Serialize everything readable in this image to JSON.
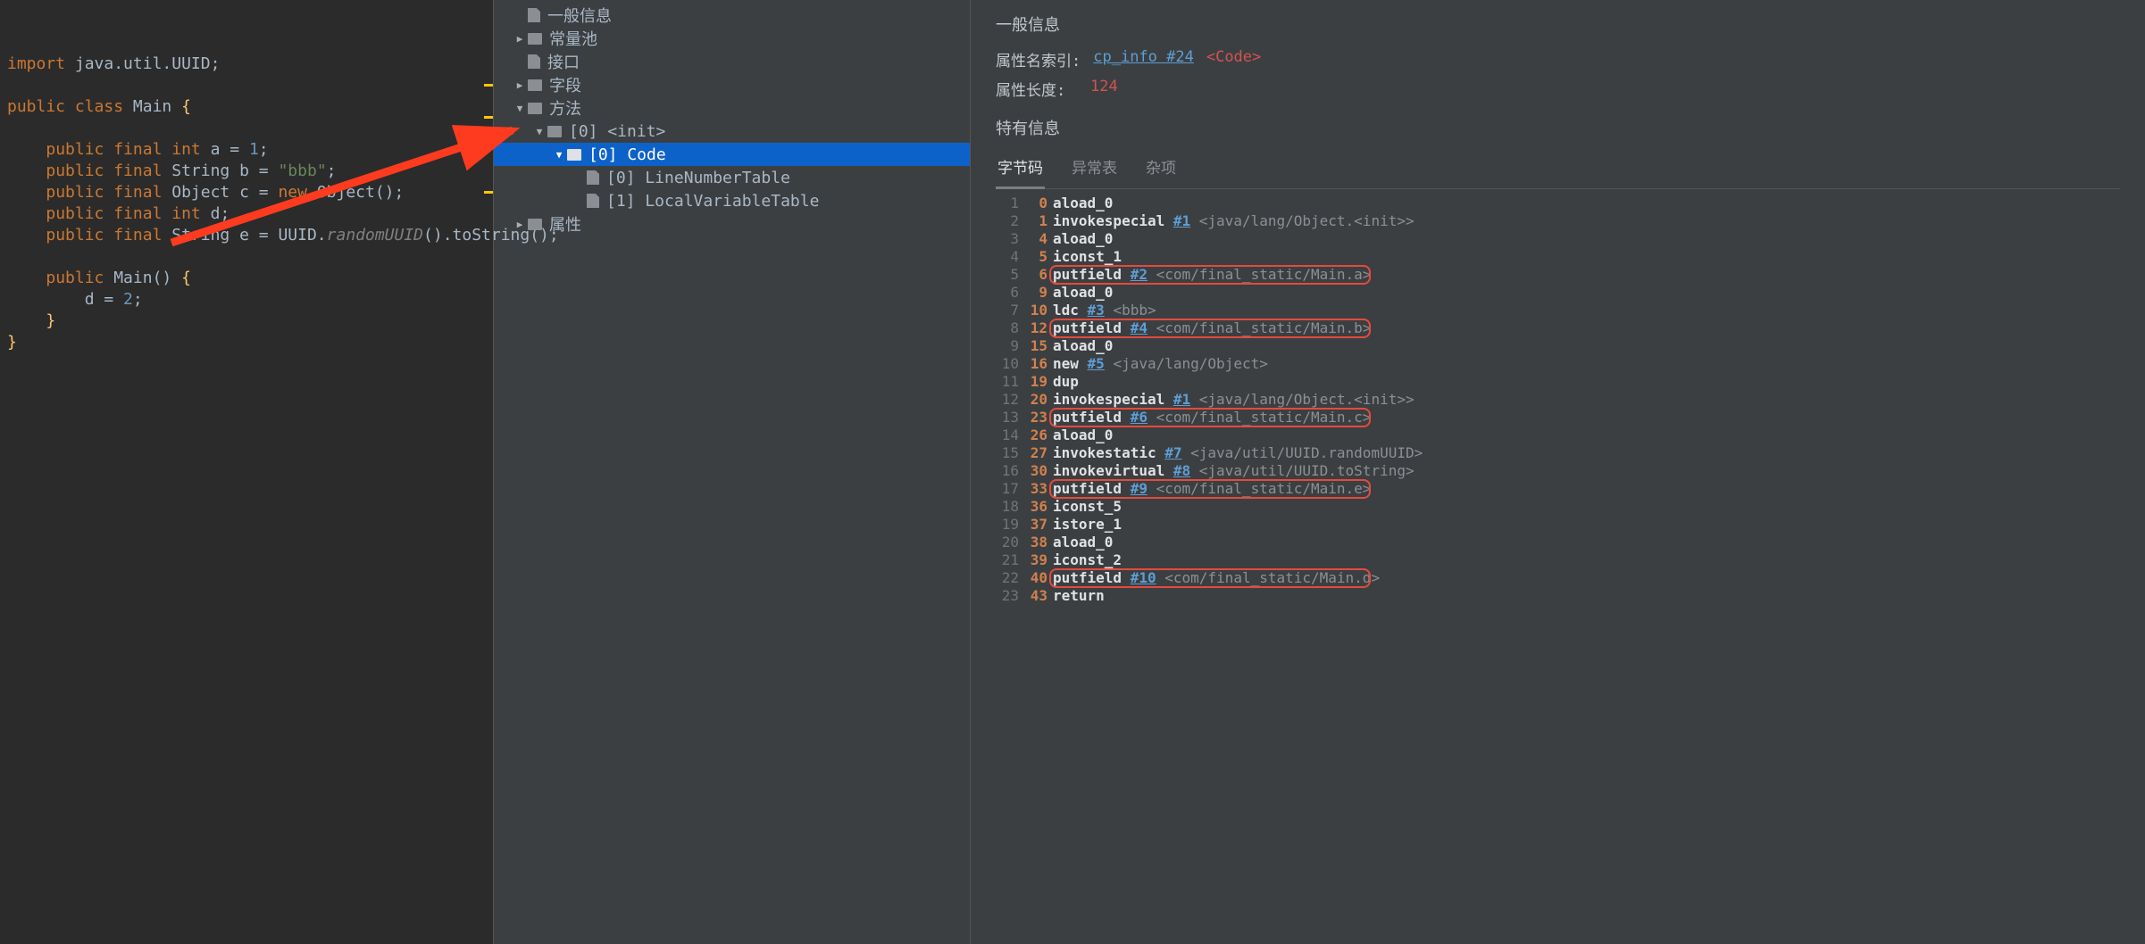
{
  "editor": {
    "lines": [
      {
        "tokens": [
          [
            "kw",
            "import"
          ],
          [
            "id",
            " java.util.UUID"
          ],
          [
            "punct",
            ";"
          ]
        ]
      },
      {
        "tokens": []
      },
      {
        "tokens": [
          [
            "kw",
            "public class"
          ],
          [
            "id",
            " "
          ],
          [
            "type",
            "Main"
          ],
          [
            "id",
            " "
          ],
          [
            "brace",
            "{"
          ]
        ]
      },
      {
        "tokens": []
      },
      {
        "tokens": [
          [
            "id",
            "    "
          ],
          [
            "kw",
            "public final int"
          ],
          [
            "id",
            " a = "
          ],
          [
            "num",
            "1"
          ],
          [
            "punct",
            ";"
          ]
        ]
      },
      {
        "tokens": [
          [
            "id",
            "    "
          ],
          [
            "kw",
            "public final "
          ],
          [
            "id",
            "String b = "
          ],
          [
            "str",
            "\"bbb\""
          ],
          [
            "punct",
            ";"
          ]
        ]
      },
      {
        "tokens": [
          [
            "id",
            "    "
          ],
          [
            "kw",
            "public final "
          ],
          [
            "id",
            "Object c = "
          ],
          [
            "kw",
            "new"
          ],
          [
            "id",
            " Object()"
          ],
          [
            "punct",
            ";"
          ]
        ]
      },
      {
        "tokens": [
          [
            "id",
            "    "
          ],
          [
            "kw",
            "public final int"
          ],
          [
            "id",
            " d"
          ],
          [
            "punct",
            ";"
          ]
        ]
      },
      {
        "tokens": [
          [
            "id",
            "    "
          ],
          [
            "kw",
            "public final "
          ],
          [
            "id",
            "String e = UUID."
          ],
          [
            "ital",
            "randomUUID"
          ],
          [
            "id",
            "().toString();"
          ]
        ]
      },
      {
        "tokens": []
      },
      {
        "tokens": [
          [
            "id",
            "    "
          ],
          [
            "kw",
            "public "
          ],
          [
            "type",
            "Main"
          ],
          [
            "id",
            "() "
          ],
          [
            "brace",
            "{"
          ]
        ]
      },
      {
        "tokens": [
          [
            "id",
            "        d = "
          ],
          [
            "num",
            "2"
          ],
          [
            "punct",
            ";"
          ]
        ]
      },
      {
        "tokens": [
          [
            "id",
            "    "
          ],
          [
            "brace",
            "}"
          ]
        ]
      },
      {
        "tokens": [
          [
            "brace",
            "}"
          ]
        ]
      }
    ]
  },
  "tree": {
    "items": [
      {
        "depth": 1,
        "toggle": "",
        "icon": "file",
        "label": "一般信息"
      },
      {
        "depth": 1,
        "toggle": "▶",
        "icon": "folder",
        "label": "常量池"
      },
      {
        "depth": 1,
        "toggle": "",
        "icon": "file",
        "label": "接口"
      },
      {
        "depth": 1,
        "toggle": "▶",
        "icon": "folder",
        "label": "字段"
      },
      {
        "depth": 1,
        "toggle": "▼",
        "icon": "folder",
        "label": "方法"
      },
      {
        "depth": 2,
        "toggle": "▼",
        "icon": "folder",
        "label": "[0] <init>"
      },
      {
        "depth": 3,
        "toggle": "▼",
        "icon": "folder",
        "label": "[0] Code",
        "selected": true
      },
      {
        "depth": 4,
        "toggle": "",
        "icon": "file",
        "label": "[0] LineNumberTable"
      },
      {
        "depth": 4,
        "toggle": "",
        "icon": "file",
        "label": "[1] LocalVariableTable"
      },
      {
        "depth": 1,
        "toggle": "▶",
        "icon": "folder",
        "label": "属性"
      }
    ]
  },
  "details": {
    "general_heading": "一般信息",
    "attr_name_label": "属性名索引:",
    "attr_name_link": "cp_info #24",
    "attr_name_tag": "<Code>",
    "attr_len_label": "属性长度:",
    "attr_len_value": "124",
    "specific_heading": "特有信息",
    "tabs": [
      "字节码",
      "异常表",
      "杂项"
    ],
    "active_tab": 0,
    "bytecode": [
      {
        "n": 1,
        "off": 0,
        "op": "aload_0"
      },
      {
        "n": 2,
        "off": 1,
        "op": "invokespecial",
        "cref": "#1",
        "cmt": "<java/lang/Object.<init>>"
      },
      {
        "n": 3,
        "off": 4,
        "op": "aload_0"
      },
      {
        "n": 4,
        "off": 5,
        "op": "iconst_1"
      },
      {
        "n": 5,
        "off": 6,
        "op": "putfield",
        "cref": "#2",
        "cmt": "<com/final_static/Main.a>",
        "hl": true
      },
      {
        "n": 6,
        "off": 9,
        "op": "aload_0"
      },
      {
        "n": 7,
        "off": 10,
        "op": "ldc",
        "cref": "#3",
        "cmt": "<bbb>"
      },
      {
        "n": 8,
        "off": 12,
        "op": "putfield",
        "cref": "#4",
        "cmt": "<com/final_static/Main.b>",
        "hl": true
      },
      {
        "n": 9,
        "off": 15,
        "op": "aload_0"
      },
      {
        "n": 10,
        "off": 16,
        "op": "new",
        "cref": "#5",
        "cmt": "<java/lang/Object>"
      },
      {
        "n": 11,
        "off": 19,
        "op": "dup"
      },
      {
        "n": 12,
        "off": 20,
        "op": "invokespecial",
        "cref": "#1",
        "cmt": "<java/lang/Object.<init>>"
      },
      {
        "n": 13,
        "off": 23,
        "op": "putfield",
        "cref": "#6",
        "cmt": "<com/final_static/Main.c>",
        "hl": true
      },
      {
        "n": 14,
        "off": 26,
        "op": "aload_0"
      },
      {
        "n": 15,
        "off": 27,
        "op": "invokestatic",
        "cref": "#7",
        "cmt": "<java/util/UUID.randomUUID>"
      },
      {
        "n": 16,
        "off": 30,
        "op": "invokevirtual",
        "cref": "#8",
        "cmt": "<java/util/UUID.toString>"
      },
      {
        "n": 17,
        "off": 33,
        "op": "putfield",
        "cref": "#9",
        "cmt": "<com/final_static/Main.e>",
        "hl": true
      },
      {
        "n": 18,
        "off": 36,
        "op": "iconst_5"
      },
      {
        "n": 19,
        "off": 37,
        "op": "istore_1"
      },
      {
        "n": 20,
        "off": 38,
        "op": "aload_0"
      },
      {
        "n": 21,
        "off": 39,
        "op": "iconst_2"
      },
      {
        "n": 22,
        "off": 40,
        "op": "putfield",
        "cref": "#10",
        "cmt": "<com/final_static/Main.d>",
        "hl": true
      },
      {
        "n": 23,
        "off": 43,
        "op": "return"
      }
    ]
  }
}
